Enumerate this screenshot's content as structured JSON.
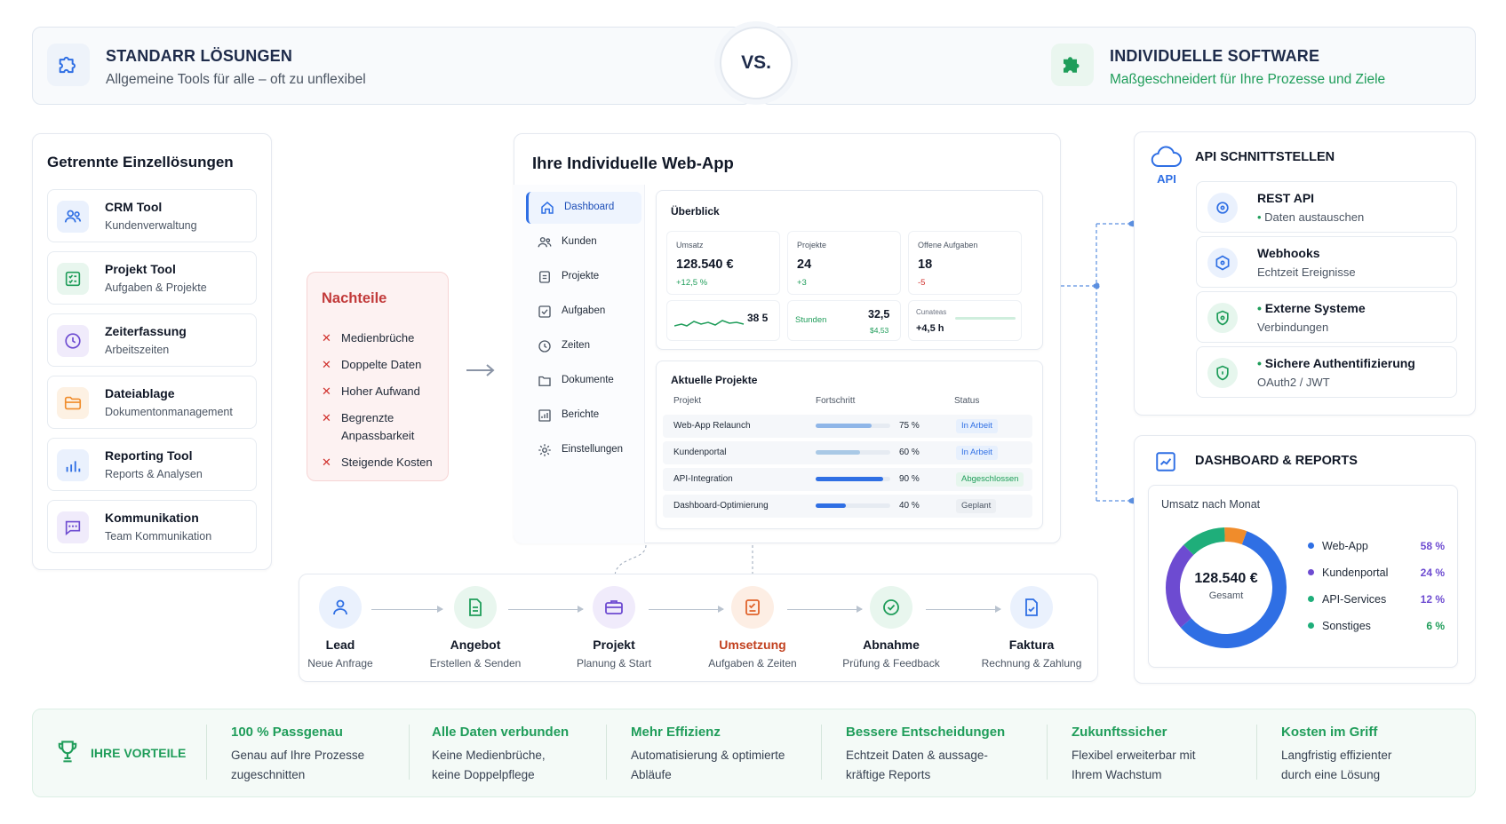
{
  "header": {
    "left": {
      "title": "STANDARR LÖSUNGEN",
      "subtitle": "Allgemeine Tools für alle – oft zu unflexibel"
    },
    "vs": "VS.",
    "right": {
      "title": "INDIVIDUELLE SOFTWARE",
      "subtitle": "Maßgeschneidert für Ihre Prozesse und Ziele"
    }
  },
  "left_panel": {
    "title": "Getrennte Einzellösungen",
    "tools": [
      {
        "name": "CRM Tool",
        "sub": "Kundenverwaltung",
        "icon": "users-icon",
        "color": "#2f6fe4"
      },
      {
        "name": "Projekt Tool",
        "sub": "Aufgaben & Projekte",
        "icon": "checklist-icon",
        "color": "#1f9d5a"
      },
      {
        "name": "Zeiterfassung",
        "sub": "Arbeitszeiten",
        "icon": "clock-icon",
        "color": "#6d4bd1"
      },
      {
        "name": "Dateiablage",
        "sub": "Dokumentonmanagement",
        "icon": "folder-icon",
        "color": "#f08c2b"
      },
      {
        "name": "Reporting Tool",
        "sub": "Reports & Analysen",
        "icon": "bar-chart-icon",
        "color": "#2f6fe4"
      },
      {
        "name": "Kommunikation",
        "sub": "Team Kommunikation",
        "icon": "chat-icon",
        "color": "#6d4bd1"
      }
    ]
  },
  "nachteile": {
    "title": "Nachteile",
    "items": [
      "Medienbrüche",
      "Doppelte Daten",
      "Hoher Aufwand",
      "Begrenzte",
      "Anpassbarkeit",
      "Steigende Kosten"
    ]
  },
  "webapp": {
    "title": "Ihre Individuelle Web-App",
    "sidebar": [
      "Dashboard",
      "Kunden",
      "Projekte",
      "Aufgaben",
      "Zeiten",
      "Dokumente",
      "Berichte",
      "Einstellungen"
    ],
    "overview": {
      "title": "Überblick",
      "stats": [
        {
          "label": "Umsatz",
          "value": "128.540 €",
          "delta": "+12,5 %"
        },
        {
          "label": "Projekte",
          "value": "24",
          "delta": "+3"
        },
        {
          "label": "Offene Aufgaben",
          "value": "18",
          "delta": "-5"
        }
      ],
      "minis": [
        {
          "value": "38 5"
        },
        {
          "label": "Stunden",
          "value": "32,5",
          "sub": "$4,53"
        },
        {
          "label": "Cunateas",
          "value": "+4,5 h"
        }
      ]
    },
    "projects": {
      "title": "Aktuelle Projekte",
      "headers": [
        "Projekt",
        "Fortschritt",
        "Status"
      ],
      "rows": [
        {
          "name": "Web-App Relaunch",
          "progress": 75,
          "pct": "75 %",
          "status": "In Arbeit"
        },
        {
          "name": "Kundenportal",
          "progress": 60,
          "pct": "60 %",
          "status": "In Arbeit"
        },
        {
          "name": "API-Integration",
          "progress": 90,
          "pct": "90 %",
          "status": "Abgeschlossen"
        },
        {
          "name": "Dashboard-Optimierung",
          "progress": 40,
          "pct": "40 %",
          "status": "Geplant"
        }
      ]
    }
  },
  "api": {
    "badge": "API",
    "title": "API SCHNITTSTELLEN",
    "items": [
      {
        "name": "REST API",
        "sub": "Daten austauschen"
      },
      {
        "name": "Webhooks",
        "sub": "Echtzeit Ereignisse"
      },
      {
        "name": "Externe Systeme",
        "sub": "Verbindungen"
      },
      {
        "name": "Sichere Authentifizierung",
        "sub": "OAuth2 / JWT"
      }
    ]
  },
  "reports": {
    "title": "DASHBOARD & REPORTS",
    "chart_title": "Umsatz nach Monat",
    "total": "128.540 €",
    "total_label": "Gesamt",
    "legend": [
      {
        "name": "Web-App",
        "pct": "58 %",
        "color": "#2f6fe4"
      },
      {
        "name": "Kundenportal",
        "pct": "24 %",
        "color": "#6d4bd1"
      },
      {
        "name": "API-Services",
        "pct": "12 %",
        "color": "#1fae7a"
      },
      {
        "name": "Sonstiges",
        "pct": "6 %",
        "color": "#1fae7a"
      }
    ]
  },
  "workflow": [
    {
      "name": "Lead",
      "sub": "Neue Anfrage",
      "color": "#2f6fe4",
      "bg": "#eaf1fd"
    },
    {
      "name": "Angebot",
      "sub": "Erstellen & Senden",
      "color": "#1f9d5a",
      "bg": "#e8f6ee"
    },
    {
      "name": "Projekt",
      "sub": "Planung & Start",
      "color": "#6d4bd1",
      "bg": "#f0ebfb"
    },
    {
      "name": "Umsetzung",
      "sub": "Aufgaben & Zeiten",
      "color": "#e0632b",
      "bg": "#fdeee4"
    },
    {
      "name": "Abnahme",
      "sub": "Prüfung & Feedback",
      "color": "#1f9d5a",
      "bg": "#e8f6ee"
    },
    {
      "name": "Faktura",
      "sub": "Rechnung & Zahlung",
      "color": "#2f6fe4",
      "bg": "#eaf1fd"
    }
  ],
  "benefits": {
    "label": "IHRE VORTEILE",
    "items": [
      {
        "title": "100 % Passgenau",
        "l1": "Genau auf Ihre Prozesse",
        "l2": "zugeschnitten"
      },
      {
        "title": "Alle Daten verbunden",
        "l1": "Keine Medienbrüche,",
        "l2": "keine Doppelpflege"
      },
      {
        "title": "Mehr Effizienz",
        "l1": "Automatisierung & optimierte",
        "l2": "Abläufe"
      },
      {
        "title": "Bessere Entscheidungen",
        "l1": "Echtzeit Daten & aussage-",
        "l2": "kräftige Reports"
      },
      {
        "title": "Zukunftssicher",
        "l1": "Flexibel erweiterbar mit",
        "l2": "Ihrem Wachstum"
      },
      {
        "title": "Kosten im Griff",
        "l1": "Langfristig effizienter",
        "l2": "durch eine Lösung"
      }
    ]
  },
  "chart_data": {
    "type": "pie",
    "title": "Umsatz nach Monat",
    "categories": [
      "Web-App",
      "Kundenportal",
      "API-Services",
      "Sonstiges"
    ],
    "values": [
      58,
      24,
      12,
      6
    ]
  }
}
